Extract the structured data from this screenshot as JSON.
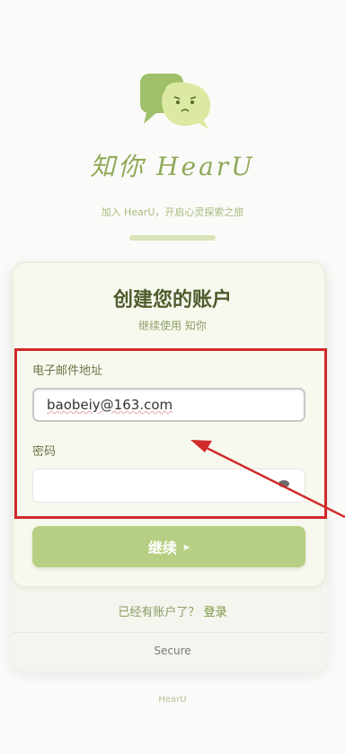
{
  "brand": {
    "name": "知你 HearU",
    "tagline": "加入 HearU，开启心灵探索之旅"
  },
  "card": {
    "title": "创建您的账户",
    "subtitle": "继续使用 知你"
  },
  "form": {
    "email_label": "电子邮件地址",
    "email_value": "baobeiy@163.com",
    "password_label": "密码",
    "password_value": "",
    "continue_label": "继续"
  },
  "login": {
    "prompt": "已经有账户了？",
    "link": "登录"
  },
  "secure_text": "Secure",
  "footer_text": "HearU",
  "colors": {
    "accent": "#b7cf82",
    "annotation": "#d02a2a"
  },
  "icons": {
    "logo": "chat-bubble-face-icon",
    "eye": "eye-icon",
    "arrow": "chevron-right-icon"
  }
}
